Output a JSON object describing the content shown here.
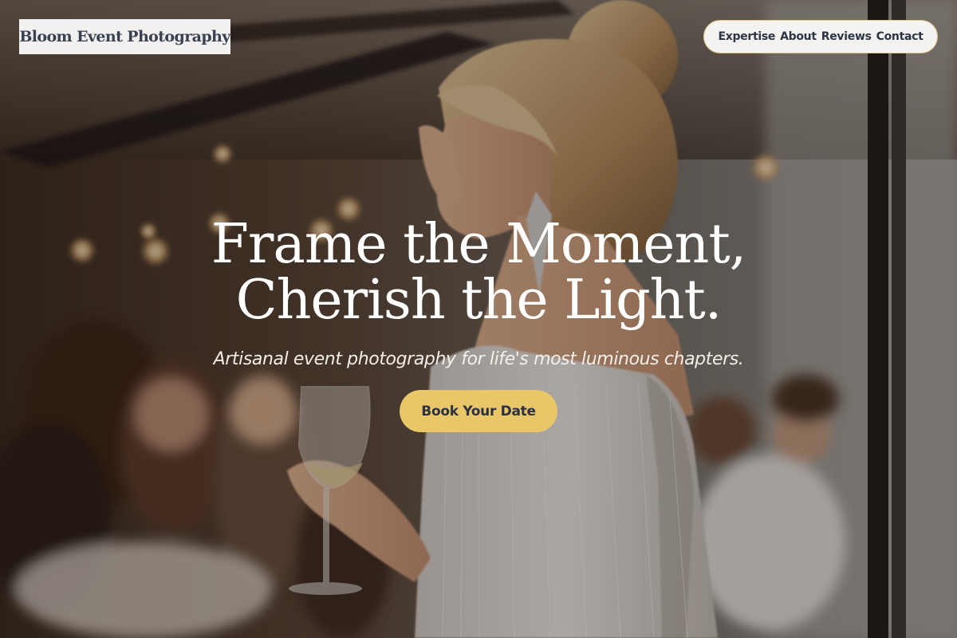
{
  "brand": {
    "name": "Bloom Event Photography"
  },
  "nav": {
    "items": [
      "Expertise",
      "About",
      "Reviews",
      "Contact"
    ]
  },
  "hero": {
    "headline_line1": "Frame the Moment,",
    "headline_line2": "Cherish the Light.",
    "subtitle": "Artisanal event photography for life's most luminous chapters.",
    "cta_label": "Book Your Date",
    "background_image": "blurred reception photo of smiling woman in fringed white dress holding a wine glass"
  },
  "colors": {
    "accent": "#e9c668",
    "nav_border": "#e0c889",
    "text_dark": "#2c3445",
    "logo_bg": "#f2f1ef"
  }
}
